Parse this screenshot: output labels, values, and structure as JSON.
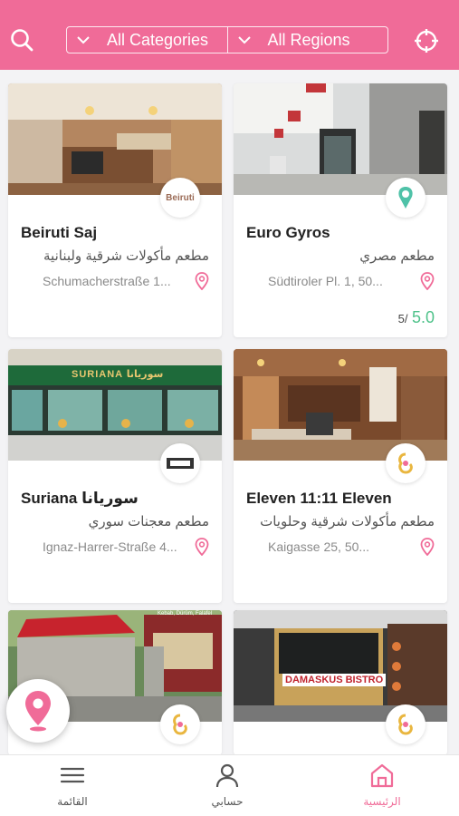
{
  "header": {
    "categories_label": "All Categories",
    "regions_label": "All Regions",
    "search_icon": "search-icon",
    "locate_icon": "crosshair-icon"
  },
  "colors": {
    "brand": "#f06b98",
    "rating": "#4fc28a"
  },
  "restaurants": [
    {
      "name": "Beiruti Saj",
      "cuisine": "مطعم مأكولات شرقية ولبنانية",
      "address": "Schumacherstraße 1...",
      "logo_text": "Beiruti"
    },
    {
      "name": "Euro Gyros",
      "cuisine": "مطعم مصري",
      "address": "Südtiroler Pl. 1, 50...",
      "rating_value": "5.0",
      "rating_max": "5/"
    },
    {
      "name": "Suriana سوريانا",
      "cuisine": "مطعم معجنات سوري",
      "address": "Ignaz-Harrer-Straße 4...",
      "photo_sign": "SURIANA  سوريانا"
    },
    {
      "name": "Eleven 11:11 Eleven",
      "cuisine": "مطعم مأكولات شرقية وحلويات",
      "address": "Kaigasse 25, 50..."
    },
    {
      "photo_sign_top": "Kebab, Dürüm, Falafel",
      "name": ""
    },
    {
      "photo_sign": "DAMASKUS BISTRO",
      "name": ""
    }
  ],
  "bottom_nav": {
    "menu_label": "القائمة",
    "account_label": "حسابي",
    "home_label": "الرئيسية"
  }
}
